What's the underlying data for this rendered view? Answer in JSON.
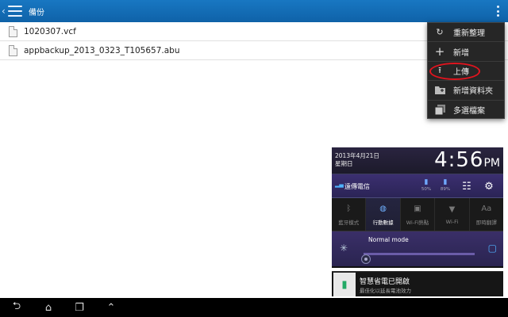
{
  "header": {
    "title": "備份"
  },
  "files": [
    {
      "name": "1020307.vcf"
    },
    {
      "name": "appbackup_2013_0323_T105657.abu"
    }
  ],
  "menu": {
    "items": [
      {
        "label": "重新整理",
        "icon": "refresh-icon"
      },
      {
        "label": "新增",
        "icon": "plus-icon"
      },
      {
        "label": "上傳",
        "icon": "upload-icon",
        "highlighted": true
      },
      {
        "label": "新增資料夾",
        "icon": "new-folder-icon"
      },
      {
        "label": "多選檔案",
        "icon": "multi-select-icon"
      }
    ]
  },
  "quick_settings": {
    "date": "2013年4月21日",
    "weekday": "星期日",
    "time": "4:56",
    "ampm": "PM",
    "carrier": "遠傳電信",
    "battery_levels": [
      "50%",
      "89%"
    ],
    "toggles": [
      {
        "label": "藍牙模式",
        "icon": "bluetooth-icon",
        "active": false
      },
      {
        "label": "行動數據",
        "icon": "mobile-data-icon",
        "active": true
      },
      {
        "label": "Wi-Fi熱點",
        "icon": "hotspot-icon",
        "active": false
      },
      {
        "label": "Wi-Fi",
        "icon": "wifi-icon",
        "active": false
      },
      {
        "label": "即時翻譯",
        "icon": "translate-icon",
        "active": false
      }
    ],
    "mode_label": "Normal mode"
  },
  "power_notification": {
    "title": "智慧省電已開啟",
    "subtitle": "最佳化以延長電池效力"
  },
  "colors": {
    "action_bar": "#1470b8",
    "highlight_ring": "#e0141e",
    "accent_blue": "#4fb3ff"
  }
}
